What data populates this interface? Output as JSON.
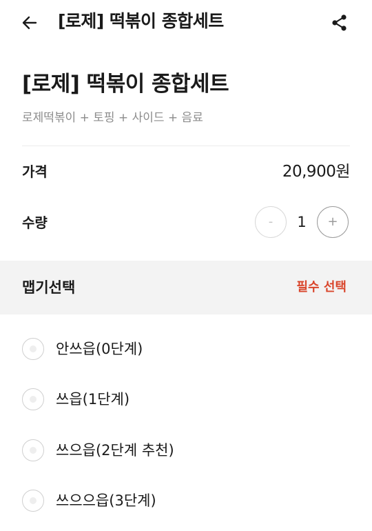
{
  "header": {
    "title": "[로제] 떡볶이 종합세트",
    "back_icon": "arrow-left-icon",
    "share_icon": "share-icon"
  },
  "product": {
    "title": "[로제] 떡볶이 종합세트",
    "description": "로제떡볶이 + 토핑 + 사이드 + 음료"
  },
  "price": {
    "label": "가격",
    "value": "20,900원"
  },
  "quantity": {
    "label": "수량",
    "value": "1",
    "minus_label": "-",
    "plus_label": "+"
  },
  "spice_section": {
    "title": "맵기선택",
    "required_label": "필수 선택",
    "options": [
      {
        "label": "안쓰읍(0단계)"
      },
      {
        "label": "쓰읍(1단계)"
      },
      {
        "label": "쓰으읍(2단계 추천)"
      },
      {
        "label": "쓰으으읍(3단계)"
      }
    ]
  },
  "colors": {
    "required": "#d9452b",
    "section_bg": "#f3f3f3",
    "muted_text": "#8c8c8c"
  }
}
